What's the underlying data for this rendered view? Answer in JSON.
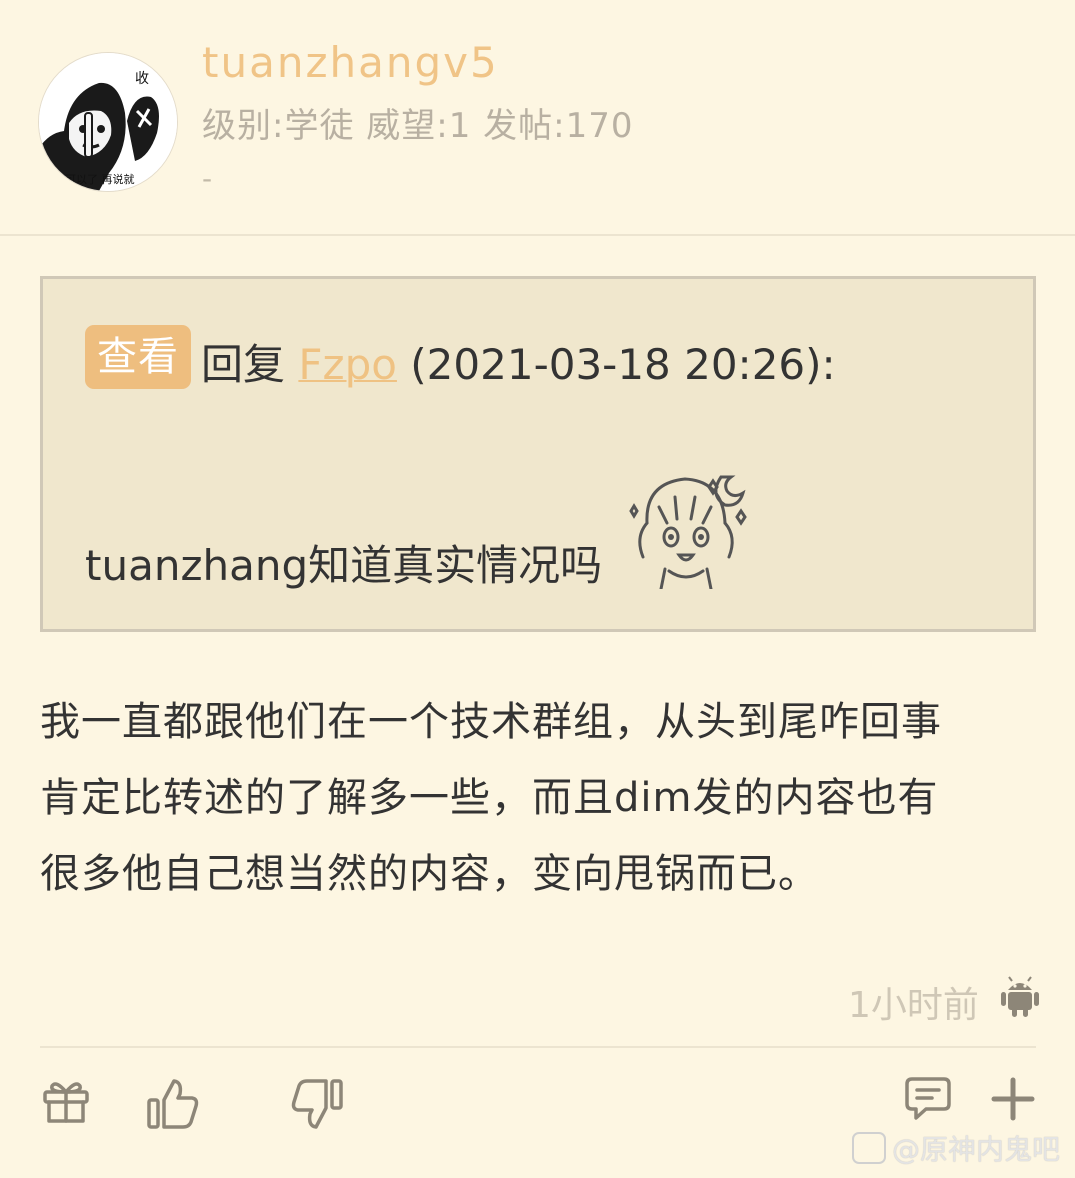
{
  "header": {
    "username": "tuanzhangv5",
    "meta": "级别:学徒 威望:1 发帖:170",
    "signature": "-",
    "avatar_icon": "meme-avatar"
  },
  "quote": {
    "view_label": "查看",
    "reply_prefix": "回复",
    "reply_user": "Fzpo",
    "reply_time": "(2021-03-18 20:26):",
    "text": "tuanzhang知道真实情况吗",
    "sticker_icon": "anime-girl-sticker"
  },
  "post": {
    "lines": [
      "我一直都跟他们在一个技术群组，从头到尾咋回事",
      "肯定比转述的了解多一些，而且dim发的内容也有",
      "很多他自己想当然的内容，变向甩锅而已。"
    ],
    "time": "1小时前",
    "device_icon": "android-icon"
  },
  "actions": {
    "gift_icon": "gift-icon",
    "like_icon": "thumbs-up-icon",
    "dislike_icon": "thumbs-down-icon",
    "comment_icon": "comment-icon",
    "more_icon": "plus-icon"
  },
  "watermark": {
    "text": "@原神内鬼吧"
  },
  "colors": {
    "background": "#fdf6e2",
    "accent": "#eebe7f",
    "quote_bg": "#f0e7cd",
    "muted": "#b8b0a2"
  }
}
